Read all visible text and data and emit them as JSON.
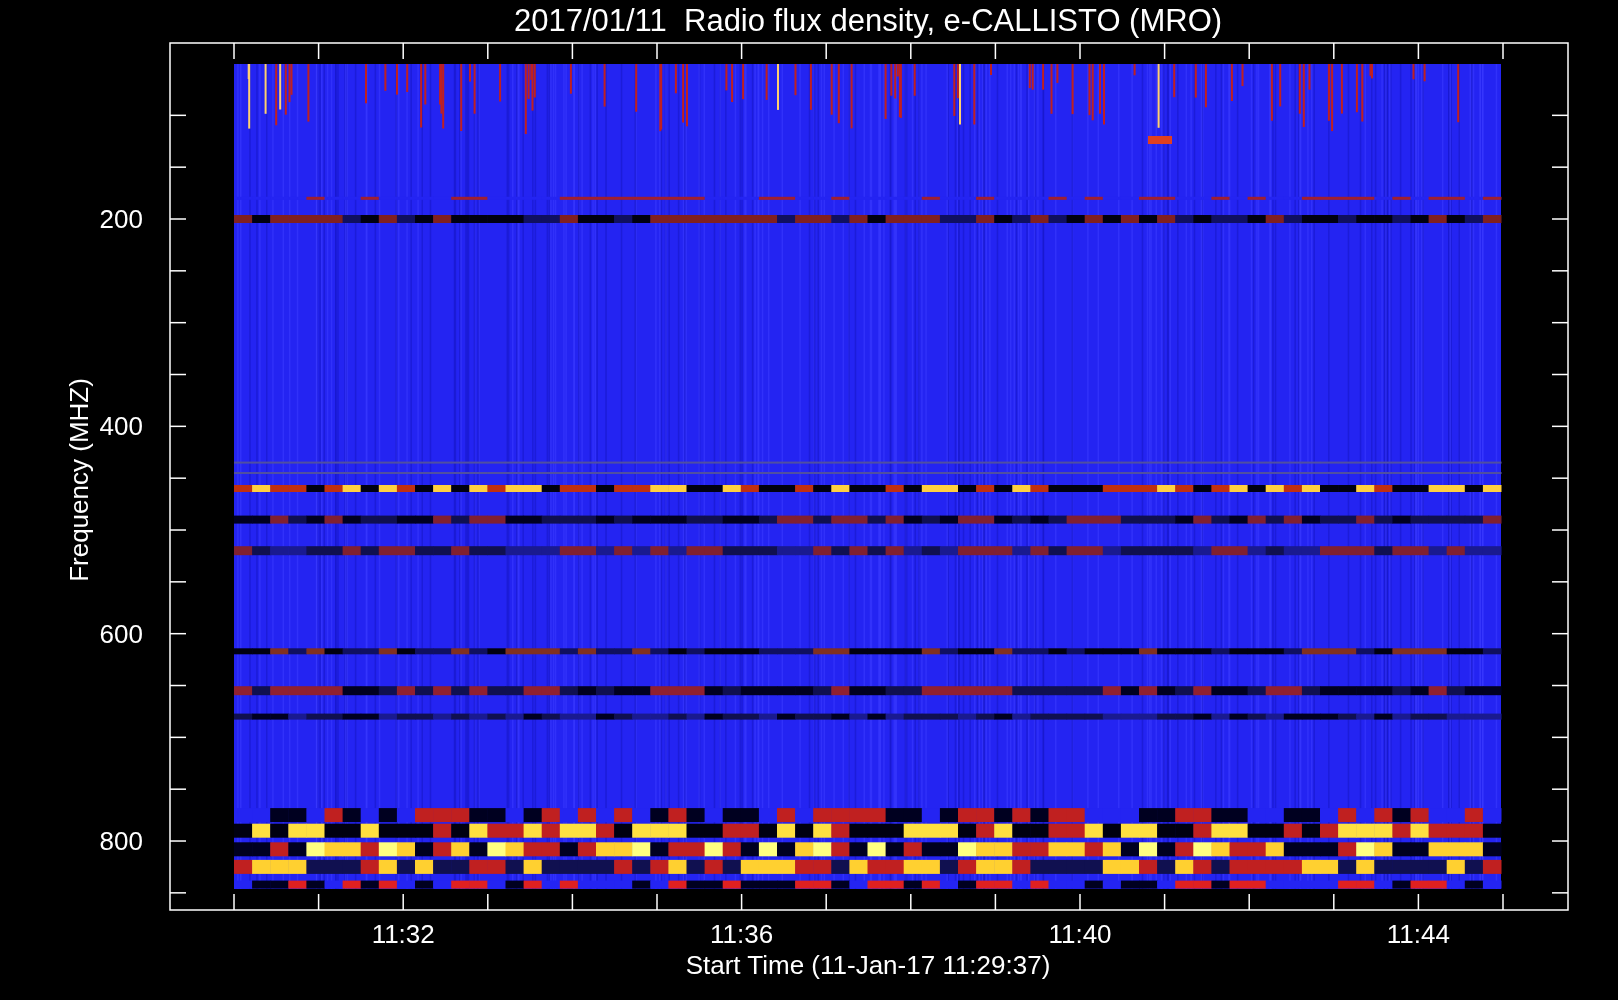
{
  "title": "2017/01/11  Radio flux density, e-CALLISTO (MRO)",
  "plot": {
    "xlabel": "Start Time (11-Jan-17 11:29:37)",
    "ylabel": "Frequency (MHZ)",
    "xticks": [
      "11:32",
      "11:36",
      "11:40",
      "11:44"
    ],
    "yticks": [
      "200",
      "400",
      "600",
      "800"
    ]
  }
}
